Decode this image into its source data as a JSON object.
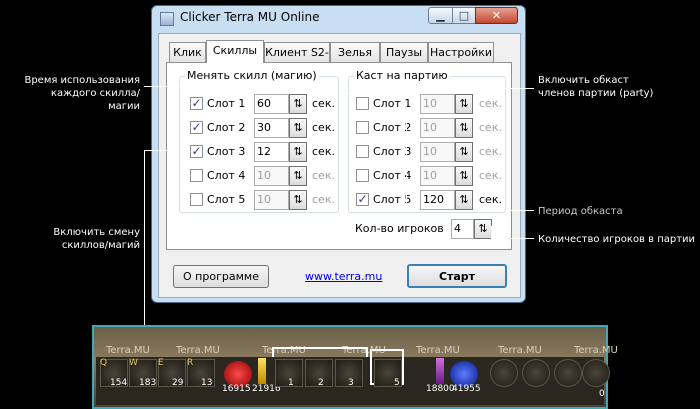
{
  "window": {
    "title": "Clicker Terra MU Online",
    "controls": {
      "minimize": "▁",
      "maximize": "□",
      "close": "✕"
    }
  },
  "tabs": [
    {
      "label": "Клик"
    },
    {
      "label": "Скиллы",
      "active": true
    },
    {
      "label": "Клиент S2-"
    },
    {
      "label": "Зелья"
    },
    {
      "label": "Паузы"
    },
    {
      "label": "Настройки"
    }
  ],
  "skills_group": {
    "title": "Менять скилл (магию)",
    "rows": [
      {
        "label": "Слот 1",
        "checked": true,
        "value": "60",
        "unit": "сек."
      },
      {
        "label": "Слот 2",
        "checked": true,
        "value": "30",
        "unit": "сек."
      },
      {
        "label": "Слот 3",
        "checked": true,
        "value": "12",
        "unit": "сек."
      },
      {
        "label": "Слот 4",
        "checked": false,
        "value": "10",
        "unit": "сек."
      },
      {
        "label": "Слот 5",
        "checked": false,
        "value": "10",
        "unit": "сек."
      }
    ]
  },
  "party_group": {
    "title": "Каст на партию",
    "rows": [
      {
        "label": "Слот 1",
        "checked": false,
        "value": "10",
        "unit": "сек."
      },
      {
        "label": "Слот 2",
        "checked": false,
        "value": "10",
        "unit": "сек."
      },
      {
        "label": "Слот 3",
        "checked": false,
        "value": "10",
        "unit": "сек."
      },
      {
        "label": "Слот 4",
        "checked": false,
        "value": "10",
        "unit": "сек."
      },
      {
        "label": "Слот 5",
        "checked": true,
        "value": "120",
        "unit": "сек."
      }
    ],
    "players_label": "Кол-во игроков",
    "players_value": "4"
  },
  "buttons": {
    "about": "О программе",
    "link": "www.terra.mu",
    "start": "Старт"
  },
  "annotations": {
    "skill_time": "Время использования\nкаждого скилла/магии",
    "enable_switch": "Включить смену\nскиллов/магий",
    "party_buff": "Включить обкаст\nчленов партии (party)",
    "buff_period": "Период обкаста",
    "players_count": "Количество игроков в партии"
  },
  "game_bar": {
    "watermark": "Terra.MU",
    "keys": [
      "Q",
      "W",
      "E",
      "R"
    ],
    "potion_counts": [
      "154",
      "183",
      "29",
      "13"
    ],
    "hp": "16915",
    "ag": "21916",
    "skill_numbers": [
      "1",
      "2",
      "3",
      "4",
      "5"
    ],
    "sd": "18800",
    "mana": "41955",
    "exp_level": "0"
  },
  "colors": {
    "link": "#0000ee",
    "window_frame": "#c8dff3",
    "gamebar_border": "#3fa7b5"
  }
}
